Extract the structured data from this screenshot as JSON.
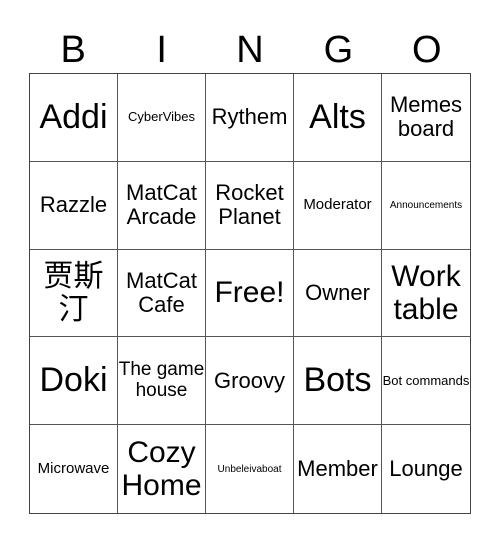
{
  "header": [
    "B",
    "I",
    "N",
    "G",
    "O"
  ],
  "cells": [
    {
      "text": "Addi",
      "size": "s-xl"
    },
    {
      "text": "CyberVibes",
      "size": "s-xs"
    },
    {
      "text": "Rythem",
      "size": "s-m"
    },
    {
      "text": "Alts",
      "size": "s-xl"
    },
    {
      "text": "Memes board",
      "size": "s-m"
    },
    {
      "text": "Razzle",
      "size": "s-m"
    },
    {
      "text": "MatCat Arcade",
      "size": "s-m"
    },
    {
      "text": "Rocket Planet",
      "size": "s-m"
    },
    {
      "text": "Moderator",
      "size": "s-s"
    },
    {
      "text": "Announcements",
      "size": "s-xxs"
    },
    {
      "text": "贾斯汀",
      "size": "s-l"
    },
    {
      "text": "MatCat Cafe",
      "size": "s-m"
    },
    {
      "text": "Free!",
      "size": "s-l"
    },
    {
      "text": "Owner",
      "size": "s-m"
    },
    {
      "text": "Work table",
      "size": "s-l"
    },
    {
      "text": "Doki",
      "size": "s-xl"
    },
    {
      "text": "The game house",
      "size": "s-ms"
    },
    {
      "text": "Groovy",
      "size": "s-m"
    },
    {
      "text": "Bots",
      "size": "s-xl"
    },
    {
      "text": "Bot commands",
      "size": "s-xs"
    },
    {
      "text": "Microwave",
      "size": "s-s"
    },
    {
      "text": "Cozy Home",
      "size": "s-l"
    },
    {
      "text": "Unbeleivaboat",
      "size": "s-xxs"
    },
    {
      "text": "Member",
      "size": "s-m"
    },
    {
      "text": "Lounge",
      "size": "s-m"
    }
  ]
}
